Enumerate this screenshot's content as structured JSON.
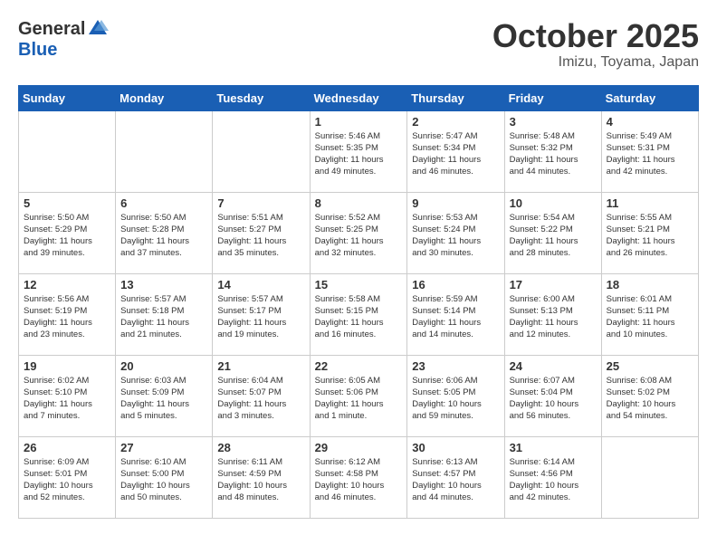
{
  "header": {
    "logo_general": "General",
    "logo_blue": "Blue",
    "month_title": "October 2025",
    "location": "Imizu, Toyama, Japan"
  },
  "days_of_week": [
    "Sunday",
    "Monday",
    "Tuesday",
    "Wednesday",
    "Thursday",
    "Friday",
    "Saturday"
  ],
  "weeks": [
    {
      "days": [
        {
          "num": "",
          "info": ""
        },
        {
          "num": "",
          "info": ""
        },
        {
          "num": "",
          "info": ""
        },
        {
          "num": "1",
          "info": "Sunrise: 5:46 AM\nSunset: 5:35 PM\nDaylight: 11 hours\nand 49 minutes."
        },
        {
          "num": "2",
          "info": "Sunrise: 5:47 AM\nSunset: 5:34 PM\nDaylight: 11 hours\nand 46 minutes."
        },
        {
          "num": "3",
          "info": "Sunrise: 5:48 AM\nSunset: 5:32 PM\nDaylight: 11 hours\nand 44 minutes."
        },
        {
          "num": "4",
          "info": "Sunrise: 5:49 AM\nSunset: 5:31 PM\nDaylight: 11 hours\nand 42 minutes."
        }
      ]
    },
    {
      "days": [
        {
          "num": "5",
          "info": "Sunrise: 5:50 AM\nSunset: 5:29 PM\nDaylight: 11 hours\nand 39 minutes."
        },
        {
          "num": "6",
          "info": "Sunrise: 5:50 AM\nSunset: 5:28 PM\nDaylight: 11 hours\nand 37 minutes."
        },
        {
          "num": "7",
          "info": "Sunrise: 5:51 AM\nSunset: 5:27 PM\nDaylight: 11 hours\nand 35 minutes."
        },
        {
          "num": "8",
          "info": "Sunrise: 5:52 AM\nSunset: 5:25 PM\nDaylight: 11 hours\nand 32 minutes."
        },
        {
          "num": "9",
          "info": "Sunrise: 5:53 AM\nSunset: 5:24 PM\nDaylight: 11 hours\nand 30 minutes."
        },
        {
          "num": "10",
          "info": "Sunrise: 5:54 AM\nSunset: 5:22 PM\nDaylight: 11 hours\nand 28 minutes."
        },
        {
          "num": "11",
          "info": "Sunrise: 5:55 AM\nSunset: 5:21 PM\nDaylight: 11 hours\nand 26 minutes."
        }
      ]
    },
    {
      "days": [
        {
          "num": "12",
          "info": "Sunrise: 5:56 AM\nSunset: 5:19 PM\nDaylight: 11 hours\nand 23 minutes."
        },
        {
          "num": "13",
          "info": "Sunrise: 5:57 AM\nSunset: 5:18 PM\nDaylight: 11 hours\nand 21 minutes."
        },
        {
          "num": "14",
          "info": "Sunrise: 5:57 AM\nSunset: 5:17 PM\nDaylight: 11 hours\nand 19 minutes."
        },
        {
          "num": "15",
          "info": "Sunrise: 5:58 AM\nSunset: 5:15 PM\nDaylight: 11 hours\nand 16 minutes."
        },
        {
          "num": "16",
          "info": "Sunrise: 5:59 AM\nSunset: 5:14 PM\nDaylight: 11 hours\nand 14 minutes."
        },
        {
          "num": "17",
          "info": "Sunrise: 6:00 AM\nSunset: 5:13 PM\nDaylight: 11 hours\nand 12 minutes."
        },
        {
          "num": "18",
          "info": "Sunrise: 6:01 AM\nSunset: 5:11 PM\nDaylight: 11 hours\nand 10 minutes."
        }
      ]
    },
    {
      "days": [
        {
          "num": "19",
          "info": "Sunrise: 6:02 AM\nSunset: 5:10 PM\nDaylight: 11 hours\nand 7 minutes."
        },
        {
          "num": "20",
          "info": "Sunrise: 6:03 AM\nSunset: 5:09 PM\nDaylight: 11 hours\nand 5 minutes."
        },
        {
          "num": "21",
          "info": "Sunrise: 6:04 AM\nSunset: 5:07 PM\nDaylight: 11 hours\nand 3 minutes."
        },
        {
          "num": "22",
          "info": "Sunrise: 6:05 AM\nSunset: 5:06 PM\nDaylight: 11 hours\nand 1 minute."
        },
        {
          "num": "23",
          "info": "Sunrise: 6:06 AM\nSunset: 5:05 PM\nDaylight: 10 hours\nand 59 minutes."
        },
        {
          "num": "24",
          "info": "Sunrise: 6:07 AM\nSunset: 5:04 PM\nDaylight: 10 hours\nand 56 minutes."
        },
        {
          "num": "25",
          "info": "Sunrise: 6:08 AM\nSunset: 5:02 PM\nDaylight: 10 hours\nand 54 minutes."
        }
      ]
    },
    {
      "days": [
        {
          "num": "26",
          "info": "Sunrise: 6:09 AM\nSunset: 5:01 PM\nDaylight: 10 hours\nand 52 minutes."
        },
        {
          "num": "27",
          "info": "Sunrise: 6:10 AM\nSunset: 5:00 PM\nDaylight: 10 hours\nand 50 minutes."
        },
        {
          "num": "28",
          "info": "Sunrise: 6:11 AM\nSunset: 4:59 PM\nDaylight: 10 hours\nand 48 minutes."
        },
        {
          "num": "29",
          "info": "Sunrise: 6:12 AM\nSunset: 4:58 PM\nDaylight: 10 hours\nand 46 minutes."
        },
        {
          "num": "30",
          "info": "Sunrise: 6:13 AM\nSunset: 4:57 PM\nDaylight: 10 hours\nand 44 minutes."
        },
        {
          "num": "31",
          "info": "Sunrise: 6:14 AM\nSunset: 4:56 PM\nDaylight: 10 hours\nand 42 minutes."
        },
        {
          "num": "",
          "info": ""
        }
      ]
    }
  ]
}
